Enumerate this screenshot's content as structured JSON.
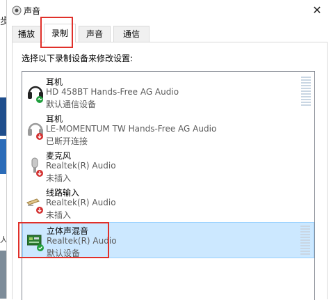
{
  "window": {
    "title": "声音",
    "close_glyph": "✕"
  },
  "background": {
    "glyph_top": "步",
    "glyph_mid": "人"
  },
  "tabs": [
    {
      "label": "播放",
      "active": false
    },
    {
      "label": "录制",
      "active": true
    },
    {
      "label": "声音",
      "active": false
    },
    {
      "label": "通信",
      "active": false
    }
  ],
  "instruction": "选择以下录制设备来修改设置:",
  "devices": [
    {
      "name": "耳机",
      "description": "HD 458BT Hands-Free AG Audio",
      "status": "默认通信设备",
      "icon": "headset-icon",
      "badge": "phone-green",
      "selected": false,
      "level": 0.0
    },
    {
      "name": "耳机",
      "description": "LE-MOMENTUM TW Hands-Free AG Audio",
      "status": "已断开连接",
      "icon": "headset-icon",
      "badge": "down-red",
      "selected": false,
      "level": null
    },
    {
      "name": "麦克风",
      "description": "Realtek(R) Audio",
      "status": "未插入",
      "icon": "microphone-icon",
      "badge": "down-red",
      "selected": false,
      "level": null
    },
    {
      "name": "线路输入",
      "description": "Realtek(R) Audio",
      "status": "未插入",
      "icon": "line-in-icon",
      "badge": "down-red",
      "selected": false,
      "level": null
    },
    {
      "name": "立体声混音",
      "description": "Realtek(R) Audio",
      "status": "默认设备",
      "icon": "circuit-board-icon",
      "badge": "check-green",
      "selected": true,
      "level": 0.0
    }
  ],
  "colors": {
    "highlight": "#e0302a",
    "selection": "#cce8ff",
    "badge_red": "#d32f2f",
    "badge_green": "#1e9e3c"
  }
}
